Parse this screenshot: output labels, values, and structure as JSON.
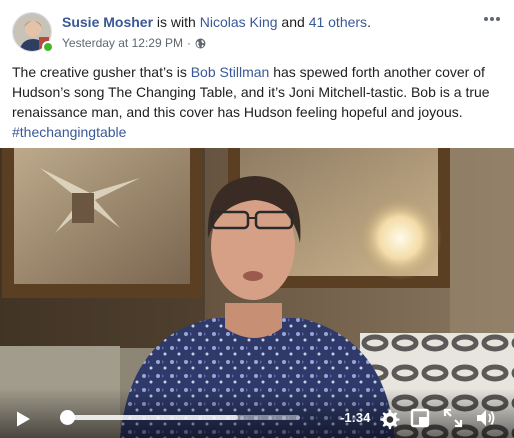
{
  "header": {
    "author": "Susie Mosher",
    "with_text": " is with ",
    "tagged_person": "Nicolas King",
    "and_text": " and ",
    "others_link": "41 others",
    "period": ".",
    "timestamp": "Yesterday at 12:29 PM",
    "separator": "·",
    "privacy_icon": "globe-icon",
    "presence_color": "#42b72a"
  },
  "post": {
    "text_1": "The creative gusher that’s is ",
    "mention": "Bob Stillman",
    "text_2": " has spewed forth another cover of Hudson’s song The Changing Table, and it’s Joni Mitchell-tastic. Bob is a true renaissance man, and this cover has Hudson feeling hopeful and joyous. ",
    "hashtag": "#thechangingtable"
  },
  "video": {
    "time_remaining": "-1:34",
    "progress_fraction": 0.02,
    "buffered_fraction": 0.74,
    "icons": [
      "play-icon",
      "settings-gear-icon",
      "picture-in-picture-icon",
      "fullscreen-icon",
      "volume-icon"
    ]
  },
  "colors": {
    "link": "#385898",
    "text": "#1c1e21",
    "muted": "#606770"
  }
}
